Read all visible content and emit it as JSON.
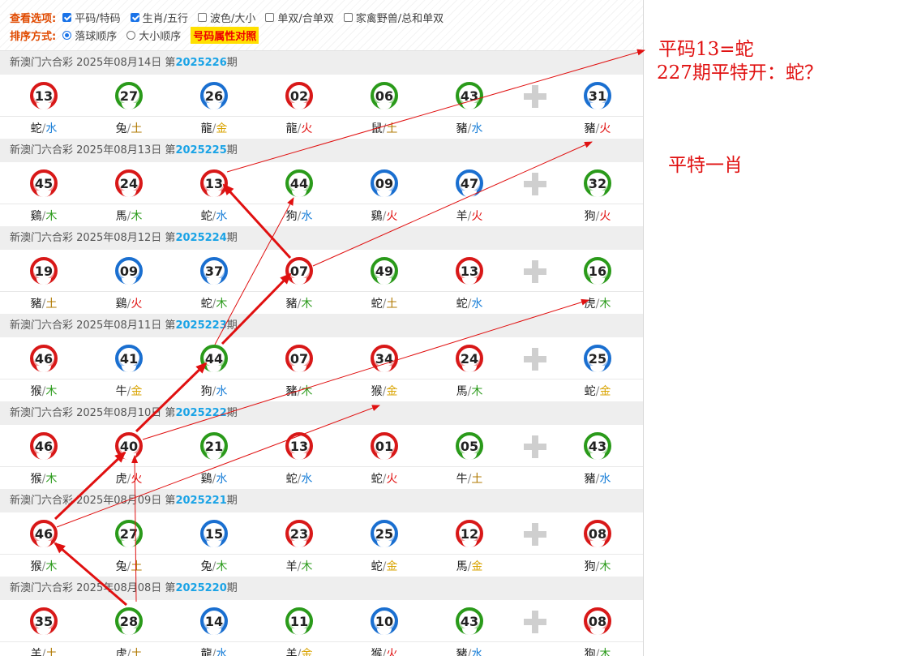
{
  "options": {
    "view_label": "查看选项:",
    "view_items": [
      {
        "label": "平码/特码",
        "checked": true
      },
      {
        "label": "生肖/五行",
        "checked": true
      },
      {
        "label": "波色/大小",
        "checked": false
      },
      {
        "label": "单双/合单双",
        "checked": false
      },
      {
        "label": "家禽野兽/总和单双",
        "checked": false
      }
    ],
    "sort_label": "排序方式:",
    "sort_items": [
      {
        "label": "落球顺序",
        "selected": true
      },
      {
        "label": "大小顺序",
        "selected": false
      }
    ],
    "compare_button": "号码属性对照"
  },
  "draws": [
    {
      "title": "新澳门六合彩 2025年08月14日 第",
      "issue": "2025226",
      "suffix": "期",
      "balls": [
        {
          "num": "13",
          "color": "red",
          "zodiac": "蛇",
          "element": "水"
        },
        {
          "num": "27",
          "color": "green",
          "zodiac": "兔",
          "element": "土"
        },
        {
          "num": "26",
          "color": "blue",
          "zodiac": "龍",
          "element": "金"
        },
        {
          "num": "02",
          "color": "red",
          "zodiac": "龍",
          "element": "火"
        },
        {
          "num": "06",
          "color": "green",
          "zodiac": "鼠",
          "element": "土"
        },
        {
          "num": "43",
          "color": "green",
          "zodiac": "豬",
          "element": "水"
        },
        {
          "num": "31",
          "color": "blue",
          "zodiac": "豬",
          "element": "火"
        }
      ]
    },
    {
      "title": "新澳门六合彩 2025年08月13日 第",
      "issue": "2025225",
      "suffix": "期",
      "balls": [
        {
          "num": "45",
          "color": "red",
          "zodiac": "鷄",
          "element": "木"
        },
        {
          "num": "24",
          "color": "red",
          "zodiac": "馬",
          "element": "木"
        },
        {
          "num": "13",
          "color": "red",
          "zodiac": "蛇",
          "element": "水"
        },
        {
          "num": "44",
          "color": "green",
          "zodiac": "狗",
          "element": "水"
        },
        {
          "num": "09",
          "color": "blue",
          "zodiac": "鷄",
          "element": "火"
        },
        {
          "num": "47",
          "color": "blue",
          "zodiac": "羊",
          "element": "火"
        },
        {
          "num": "32",
          "color": "green",
          "zodiac": "狗",
          "element": "火"
        }
      ]
    },
    {
      "title": "新澳门六合彩 2025年08月12日 第",
      "issue": "2025224",
      "suffix": "期",
      "balls": [
        {
          "num": "19",
          "color": "red",
          "zodiac": "豬",
          "element": "土"
        },
        {
          "num": "09",
          "color": "blue",
          "zodiac": "鷄",
          "element": "火"
        },
        {
          "num": "37",
          "color": "blue",
          "zodiac": "蛇",
          "element": "木"
        },
        {
          "num": "07",
          "color": "red",
          "zodiac": "豬",
          "element": "木"
        },
        {
          "num": "49",
          "color": "green",
          "zodiac": "蛇",
          "element": "土"
        },
        {
          "num": "13",
          "color": "red",
          "zodiac": "蛇",
          "element": "水"
        },
        {
          "num": "16",
          "color": "green",
          "zodiac": "虎",
          "element": "木"
        }
      ]
    },
    {
      "title": "新澳门六合彩 2025年08月11日 第",
      "issue": "2025223",
      "suffix": "期",
      "balls": [
        {
          "num": "46",
          "color": "red",
          "zodiac": "猴",
          "element": "木"
        },
        {
          "num": "41",
          "color": "blue",
          "zodiac": "牛",
          "element": "金"
        },
        {
          "num": "44",
          "color": "green",
          "zodiac": "狗",
          "element": "水"
        },
        {
          "num": "07",
          "color": "red",
          "zodiac": "豬",
          "element": "木"
        },
        {
          "num": "34",
          "color": "red",
          "zodiac": "猴",
          "element": "金"
        },
        {
          "num": "24",
          "color": "red",
          "zodiac": "馬",
          "element": "木"
        },
        {
          "num": "25",
          "color": "blue",
          "zodiac": "蛇",
          "element": "金"
        }
      ]
    },
    {
      "title": "新澳门六合彩 2025年08月10日 第",
      "issue": "2025222",
      "suffix": "期",
      "balls": [
        {
          "num": "46",
          "color": "red",
          "zodiac": "猴",
          "element": "木"
        },
        {
          "num": "40",
          "color": "red",
          "zodiac": "虎",
          "element": "火"
        },
        {
          "num": "21",
          "color": "green",
          "zodiac": "鷄",
          "element": "水"
        },
        {
          "num": "13",
          "color": "red",
          "zodiac": "蛇",
          "element": "水"
        },
        {
          "num": "01",
          "color": "red",
          "zodiac": "蛇",
          "element": "火"
        },
        {
          "num": "05",
          "color": "green",
          "zodiac": "牛",
          "element": "土"
        },
        {
          "num": "43",
          "color": "green",
          "zodiac": "豬",
          "element": "水"
        }
      ]
    },
    {
      "title": "新澳门六合彩 2025年08月09日 第",
      "issue": "2025221",
      "suffix": "期",
      "balls": [
        {
          "num": "46",
          "color": "red",
          "zodiac": "猴",
          "element": "木"
        },
        {
          "num": "27",
          "color": "green",
          "zodiac": "兔",
          "element": "土"
        },
        {
          "num": "15",
          "color": "blue",
          "zodiac": "兔",
          "element": "木"
        },
        {
          "num": "23",
          "color": "red",
          "zodiac": "羊",
          "element": "木"
        },
        {
          "num": "25",
          "color": "blue",
          "zodiac": "蛇",
          "element": "金"
        },
        {
          "num": "12",
          "color": "red",
          "zodiac": "馬",
          "element": "金"
        },
        {
          "num": "08",
          "color": "red",
          "zodiac": "狗",
          "element": "木"
        }
      ]
    },
    {
      "title": "新澳门六合彩 2025年08月08日 第",
      "issue": "2025220",
      "suffix": "期",
      "balls": [
        {
          "num": "35",
          "color": "red",
          "zodiac": "羊",
          "element": "土"
        },
        {
          "num": "28",
          "color": "green",
          "zodiac": "虎",
          "element": "土"
        },
        {
          "num": "14",
          "color": "blue",
          "zodiac": "龍",
          "element": "水"
        },
        {
          "num": "11",
          "color": "green",
          "zodiac": "羊",
          "element": "金"
        },
        {
          "num": "10",
          "color": "blue",
          "zodiac": "猴",
          "element": "火"
        },
        {
          "num": "43",
          "color": "green",
          "zodiac": "豬",
          "element": "水"
        },
        {
          "num": "08",
          "color": "red",
          "zodiac": "狗",
          "element": "木"
        }
      ]
    }
  ],
  "annotations": {
    "line1": "平码13=蛇",
    "line2": "227期平特开：蛇？",
    "line3": "平特一肖"
  }
}
